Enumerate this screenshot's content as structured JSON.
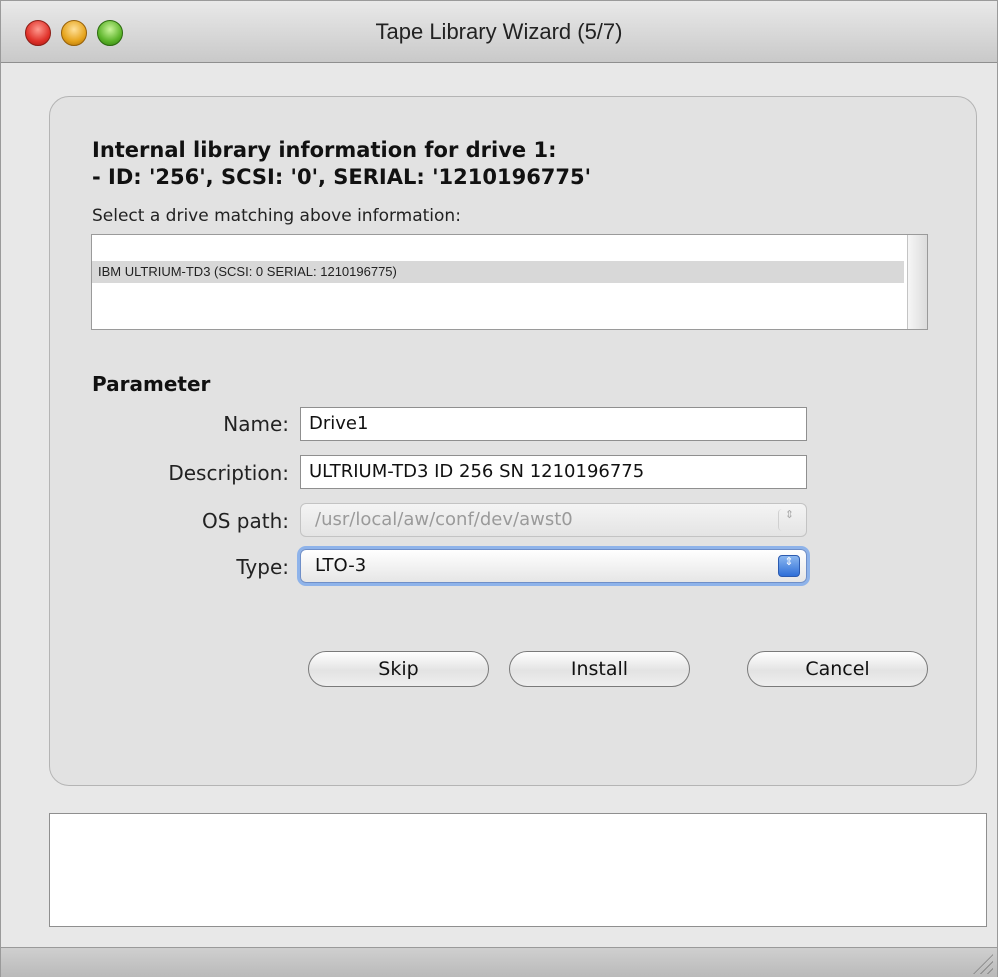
{
  "window": {
    "title": "Tape Library Wizard (5/7)"
  },
  "info": {
    "line1": "Internal library information for drive 1:",
    "line2": "- ID: '256', SCSI: '0', SERIAL: '1210196775'",
    "select_prompt": "Select a drive matching above information:"
  },
  "drives": [
    {
      "label": "IBM ULTRIUM-TD3 (SCSI: 0 SERIAL: 1210196775)",
      "selected": true
    }
  ],
  "parameter": {
    "title": "Parameter",
    "name_label": "Name:",
    "name_value": "Drive1",
    "description_label": "Description:",
    "description_value": "ULTRIUM-TD3 ID 256 SN 1210196775",
    "ospath_label": "OS path:",
    "ospath_value": "/usr/local/aw/conf/dev/awst0",
    "type_label": "Type:",
    "type_value": "LTO-3"
  },
  "buttons": {
    "skip": "Skip",
    "install": "Install",
    "cancel": "Cancel"
  },
  "icons": {
    "popup_arrows": "⇕"
  }
}
